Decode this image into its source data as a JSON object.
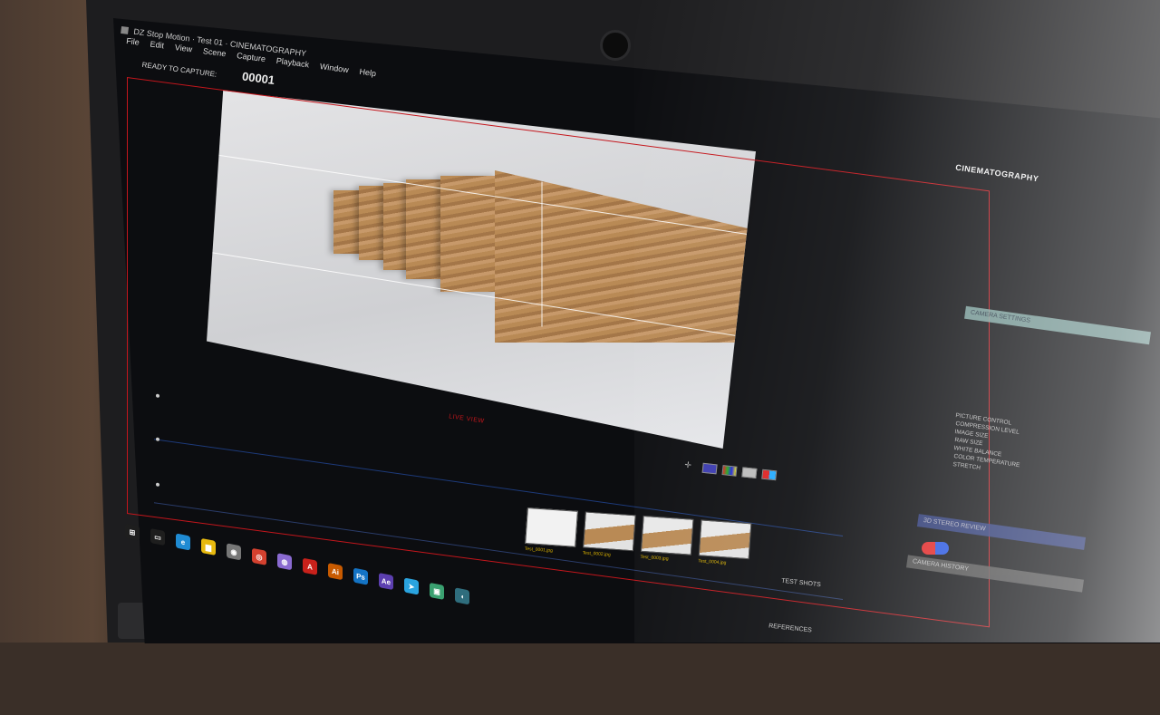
{
  "app": {
    "title": "DZ Stop Motion · Test 01 · CINEMATOGRAPHY",
    "menu": [
      "File",
      "Edit",
      "View",
      "Scene",
      "Capture",
      "Playback",
      "Window",
      "Help"
    ],
    "status_label": "READY TO CAPTURE:",
    "frame_counter": "00001",
    "workspace": "CINEMATOGRAPHY",
    "live_view_label": "LIVE VIEW"
  },
  "right_panel": {
    "camera_settings": "CAMERA SETTINGS",
    "settings_rows": [
      "PICTURE CONTROL",
      "COMPRESSION LEVEL",
      "IMAGE SIZE",
      "RAW SIZE",
      "WHITE BALANCE",
      "COLOR TEMPERATURE",
      "STRETCH"
    ],
    "onion_skin_label": "3D STEREO REVIEW",
    "camera_history": "CAMERA HISTORY"
  },
  "bottom": {
    "test_shots_label": "TEST SHOTS",
    "references_label": "REFERENCES",
    "thumbnails": [
      {
        "caption": "Test_0001.jpg",
        "kind": "blank"
      },
      {
        "caption": "Test_0002.jpg",
        "kind": "wood"
      },
      {
        "caption": "Test_0003.jpg",
        "kind": "wood"
      },
      {
        "caption": "Test_0004.jpg",
        "kind": "wood"
      }
    ]
  },
  "taskbar": {
    "items": [
      {
        "name": "windows-start-icon",
        "glyph": "⊞",
        "color": "#1e1e1e"
      },
      {
        "name": "task-view-icon",
        "glyph": "▭",
        "color": "#1e1e1e"
      },
      {
        "name": "edge-icon",
        "glyph": "e",
        "color": "#1f8bd3"
      },
      {
        "name": "file-explorer-icon",
        "glyph": "▆",
        "color": "#e7b90f"
      },
      {
        "name": "camera-app-icon",
        "glyph": "◉",
        "color": "#777777"
      },
      {
        "name": "chrome-icon",
        "glyph": "◎",
        "color": "#d4412f"
      },
      {
        "name": "app-violet-icon",
        "glyph": "◍",
        "color": "#8a6ad1"
      },
      {
        "name": "acrobat-icon",
        "glyph": "A",
        "color": "#c8211b"
      },
      {
        "name": "illustrator-icon",
        "glyph": "Ai",
        "color": "#c85a00"
      },
      {
        "name": "photoshop-icon",
        "glyph": "Ps",
        "color": "#1473c4"
      },
      {
        "name": "after-effects-icon",
        "glyph": "Ae",
        "color": "#5c3fb0"
      },
      {
        "name": "telegram-icon",
        "glyph": "➤",
        "color": "#2aa3df"
      },
      {
        "name": "app-green-icon",
        "glyph": "▣",
        "color": "#3aa070"
      },
      {
        "name": "dragonframe-icon",
        "glyph": "◖",
        "color": "#2f6d7d"
      }
    ]
  }
}
